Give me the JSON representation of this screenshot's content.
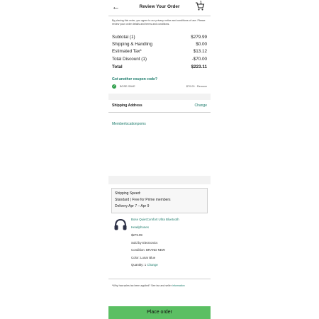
{
  "header": {
    "title": "Review Your Order",
    "cart_count": "1"
  },
  "notice": "By placing this order, you agree to our privacy notice and conditions of use. Please review your order details and terms and conditions.",
  "summary": {
    "subtotal_label": "Subtotal (1)",
    "subtotal_value": "$279.99",
    "shipping_label": "Shipping & Handling",
    "shipping_value": "$0.00",
    "tax_label": "Estimated Tax*",
    "tax_value": "$13.12",
    "discount_label": "Total Discount (1)",
    "discount_value": "-$70.00",
    "total_label": "Total",
    "total_value": "$223.11"
  },
  "coupon": {
    "link": "Got another coupon code?",
    "code": "BOSE-SAVE",
    "amount": "$70.00 · Remove"
  },
  "shipping": {
    "heading": "Shipping Address",
    "change": "Change",
    "name": "Memberlocationpoms"
  },
  "speed": {
    "label": "Shipping Speed:",
    "option": "Standard | Free for Prime members",
    "delivery": "Delivery Apr 7 – Apr 9"
  },
  "product": {
    "name_line1": "Bose QuietComfort Ultra Bluetooth",
    "name_line2": "Headphones",
    "price": "$279.99",
    "sold_by": "Sold by Electronics",
    "condition": "Condition: BRAND NEW",
    "color": "Color: Lunar Blue",
    "quantity_label": "Quantity: 1",
    "quantity_change": "Change"
  },
  "footer": {
    "text": "*Why has sales tax been applied? See tax and seller",
    "link": "information"
  },
  "place_order": "Place order",
  "colors": {
    "accent": "#1a7a6a",
    "button": "#5bbf63",
    "check": "#2e9e4a"
  }
}
